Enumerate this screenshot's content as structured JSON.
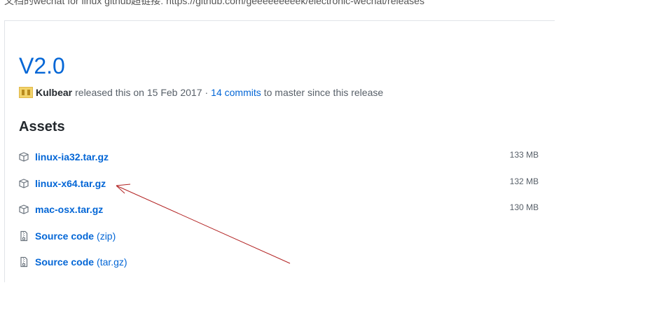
{
  "top_note": "文档的wechat for linux github超链接: https://github.com/geeeeeeeeek/electronic-wechat/releases",
  "release": {
    "title": "V2.0",
    "author": "Kulbear",
    "released_text": "released this on 15 Feb 2017",
    "separator": "·",
    "commits_link": "14 commits",
    "commits_suffix": "to master since this release"
  },
  "assets": {
    "heading": "Assets",
    "items": [
      {
        "name": "linux-ia32.tar.gz",
        "suffix": "",
        "size": "133 MB",
        "icon": "package-icon"
      },
      {
        "name": "linux-x64.tar.gz",
        "suffix": "",
        "size": "132 MB",
        "icon": "package-icon"
      },
      {
        "name": "mac-osx.tar.gz",
        "suffix": "",
        "size": "130 MB",
        "icon": "package-icon"
      },
      {
        "name": "Source code",
        "suffix": "(zip)",
        "size": "",
        "icon": "file-zip-icon"
      },
      {
        "name": "Source code",
        "suffix": "(tar.gz)",
        "size": "",
        "icon": "file-zip-icon"
      }
    ]
  },
  "annotation": {
    "color": "#b22222",
    "type": "arrow pointing to linux-x64.tar.gz"
  }
}
